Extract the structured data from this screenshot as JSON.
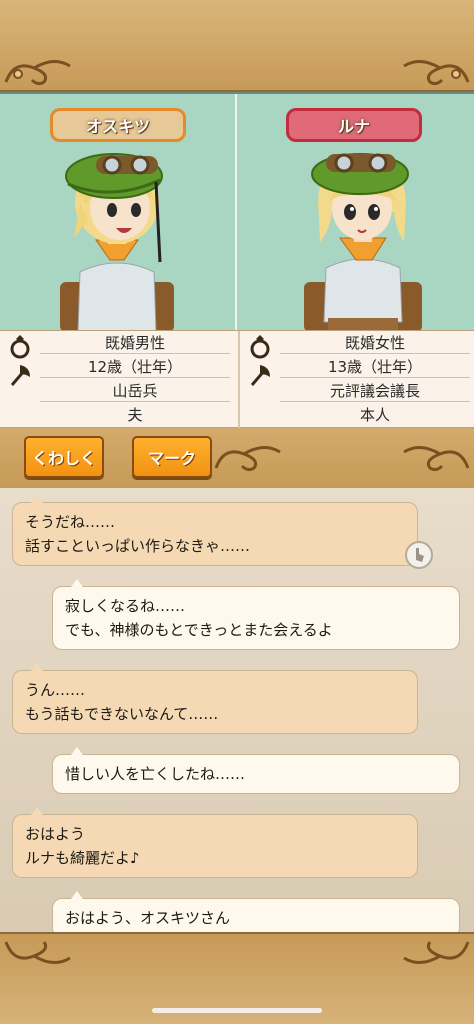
{
  "characters": {
    "left": {
      "name": "オスキツ",
      "stats": [
        "既婚男性",
        "12歳（壮年）",
        "山岳兵",
        "夫"
      ]
    },
    "right": {
      "name": "ルナ",
      "stats": [
        "既婚女性",
        "13歳（壮年）",
        "元評議会議長",
        "本人"
      ]
    }
  },
  "buttons": {
    "details": "くわしく",
    "mark": "マーク"
  },
  "chat": [
    {
      "side": "left",
      "text": "そうだね……\n話すこといっぱい作らなきゃ……"
    },
    {
      "side": "right",
      "text": "寂しくなるね……\nでも、神様のもとできっとまた会えるよ"
    },
    {
      "side": "left",
      "text": "うん……\nもう話もできないなんて……"
    },
    {
      "side": "right",
      "text": "惜しい人を亡くしたね……"
    },
    {
      "side": "left",
      "text": "おはよう\nルナも綺麗だよ♪"
    },
    {
      "side": "right",
      "text": "おはよう、オスキツさん"
    }
  ],
  "icons": {
    "ring": "ring-icon",
    "job": "axe-icon",
    "tap": "tap-icon"
  }
}
